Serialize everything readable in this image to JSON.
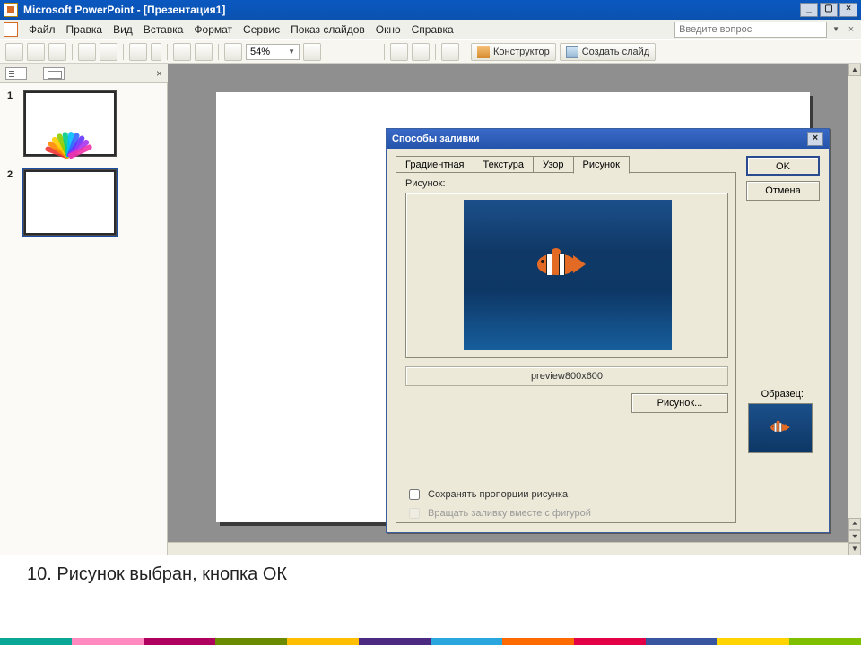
{
  "titlebar": {
    "text": "Microsoft PowerPoint - [Презентация1]"
  },
  "menu": {
    "items": [
      "Файл",
      "Правка",
      "Вид",
      "Вставка",
      "Формат",
      "Сервис",
      "Показ слайдов",
      "Окно",
      "Справка"
    ],
    "ask_placeholder": "Введите вопрос"
  },
  "toolbar": {
    "zoom": "54%",
    "designer_label": "Конструктор",
    "newslide_label": "Создать слайд"
  },
  "thumbnails": {
    "slides": [
      {
        "num": "1"
      },
      {
        "num": "2"
      }
    ]
  },
  "dialog": {
    "title": "Способы заливки",
    "tabs": [
      "Градиентная",
      "Текстура",
      "Узор",
      "Рисунок"
    ],
    "picture_label": "Рисунок:",
    "filename": "preview800x600",
    "browse": "Рисунок...",
    "aspect": "Сохранять пропорции рисунка",
    "rotate": "Вращать заливку вместе с фигурой",
    "ok": "OK",
    "cancel": "Отмена",
    "sample_label": "Образец:"
  },
  "caption": "10.   Рисунок выбран, кнопка ОК",
  "colors": [
    "#0aa696",
    "#ff8ac2",
    "#b0005f",
    "#6a8b00",
    "#ffbe00",
    "#4d2a82",
    "#2aa6de",
    "#ff6a00",
    "#e40046",
    "#3a55a0",
    "#ffd400",
    "#7ebf00"
  ]
}
